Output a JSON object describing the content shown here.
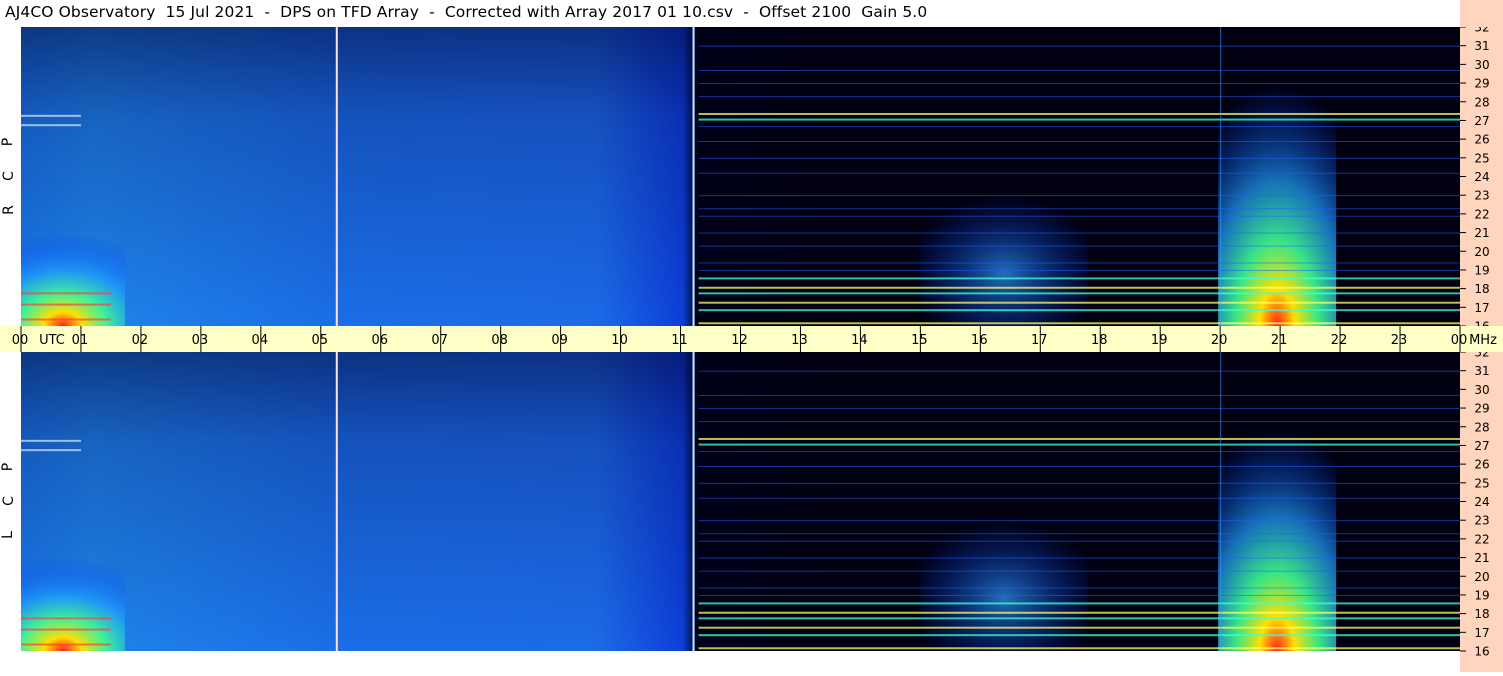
{
  "title": "AJ4CO Observatory  15 Jul 2021  -  DPS on TFD Array  -  Corrected with Array 2017 01 10.csv  -  Offset 2100  Gain 5.0",
  "panels": [
    {
      "polarization": "RCP",
      "letters": [
        "P",
        "C",
        "R"
      ]
    },
    {
      "polarization": "LCP",
      "letters": [
        "P",
        "C",
        "L"
      ]
    }
  ],
  "time_axis": {
    "ticks": [
      "00",
      "01",
      "02",
      "03",
      "04",
      "05",
      "06",
      "07",
      "08",
      "09",
      "10",
      "11",
      "12",
      "13",
      "14",
      "15",
      "16",
      "17",
      "18",
      "19",
      "20",
      "21",
      "22",
      "23",
      "00"
    ],
    "utc_label": "UTC",
    "unit_label": "MHz"
  },
  "chart_data": {
    "type": "heatmap",
    "title": "AJ4CO Observatory  15 Jul 2021  -  DPS on TFD Array  -  Corrected with Array 2017 01 10.csv  -  Offset 2100  Gain 5.0",
    "xlabel": "UTC",
    "ylabel": "MHz",
    "x_range_hours": [
      0,
      24
    ],
    "y_range_mhz": [
      16,
      32
    ],
    "y_ticks": [
      16,
      17,
      18,
      19,
      20,
      21,
      22,
      23,
      24,
      25,
      26,
      27,
      28,
      29,
      30,
      31,
      32
    ],
    "series": [
      {
        "name": "RCP",
        "description_hot_regions": [
          {
            "x_hours": [
              0,
              1.4
            ],
            "y_mhz": [
              16,
              21
            ]
          },
          {
            "x_hours": [
              20.3,
              21.6
            ],
            "y_mhz": [
              16,
              29
            ]
          }
        ]
      },
      {
        "name": "LCP",
        "description_hot_regions": [
          {
            "x_hours": [
              0,
              1.4
            ],
            "y_mhz": [
              16,
              21
            ]
          },
          {
            "x_hours": [
              20.3,
              21.6
            ],
            "y_mhz": [
              16,
              28
            ]
          }
        ]
      }
    ],
    "vertical_markers_hours": [
      5.25,
      11.2
    ],
    "colors": {
      "low": "#000000",
      "mid": "#0050ff",
      "high": "#ffff00",
      "peak": "#ff0000"
    }
  }
}
